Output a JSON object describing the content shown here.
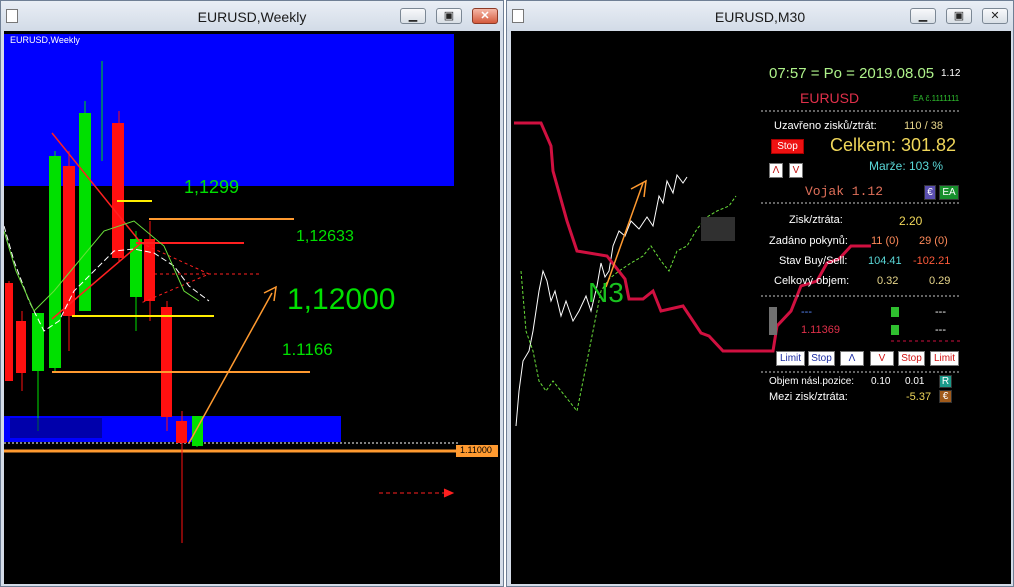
{
  "windows": {
    "left": {
      "title": "EURUSD,Weekly",
      "inner_label": "EURUSD,Weekly"
    },
    "right": {
      "title": "EURUSD,M30"
    }
  },
  "left_chart": {
    "levels": {
      "a": "1,1299",
      "b": "1,12633",
      "c": "1,12000",
      "d": "1.1166",
      "e": "1.11000"
    },
    "colors": {
      "bull": "#00e000",
      "bear": "#ff1010",
      "zone": "#0000ff",
      "level": "#ff9a30"
    }
  },
  "right_chart": {
    "label": "N3",
    "panel": {
      "time": "07:57 = Po = 2019.08.05",
      "version_small": "1.12",
      "symbol": "EURUSD",
      "ea_number": "EA č.1111111",
      "closed_label": "Uzavřeno zisků/ztrát:",
      "closed_value": "110 / 38",
      "stop_label": "Stop",
      "total_label": "Celkem: 301.82",
      "margin_label": "Marže:  103 %",
      "up_label": "Λ",
      "down_label": "V",
      "vojak": "Vojak 1.12",
      "e_badge": "€",
      "ea_badge": "EA",
      "rows": [
        {
          "label": "Zisk/ztráta:",
          "v1": "2.20",
          "v2": ""
        },
        {
          "label": "Zadáno pokynů:",
          "v1": "11 (0)",
          "v2": "29 (0)"
        },
        {
          "label": "Stav Buy/Sell:",
          "v1": "104.41",
          "v2": "-102.21"
        },
        {
          "label": "Celkový objem:",
          "v1": "0.32",
          "v2": "0.29"
        }
      ],
      "dash_a": "---",
      "dash_b": "---",
      "price": "1.11369",
      "dash_c": "---",
      "buttons": [
        "Limit",
        "Stop",
        "Λ",
        "V",
        "Stop",
        "Limit"
      ],
      "next_vol_label": "Objem násl.pozice:",
      "next_vol_1": "0.10",
      "next_vol_2": "0.01",
      "r_badge": "R",
      "mid_label": "Mezi zisk/ztráta:",
      "mid_value": "-5.37",
      "euro_badge": "€"
    }
  }
}
